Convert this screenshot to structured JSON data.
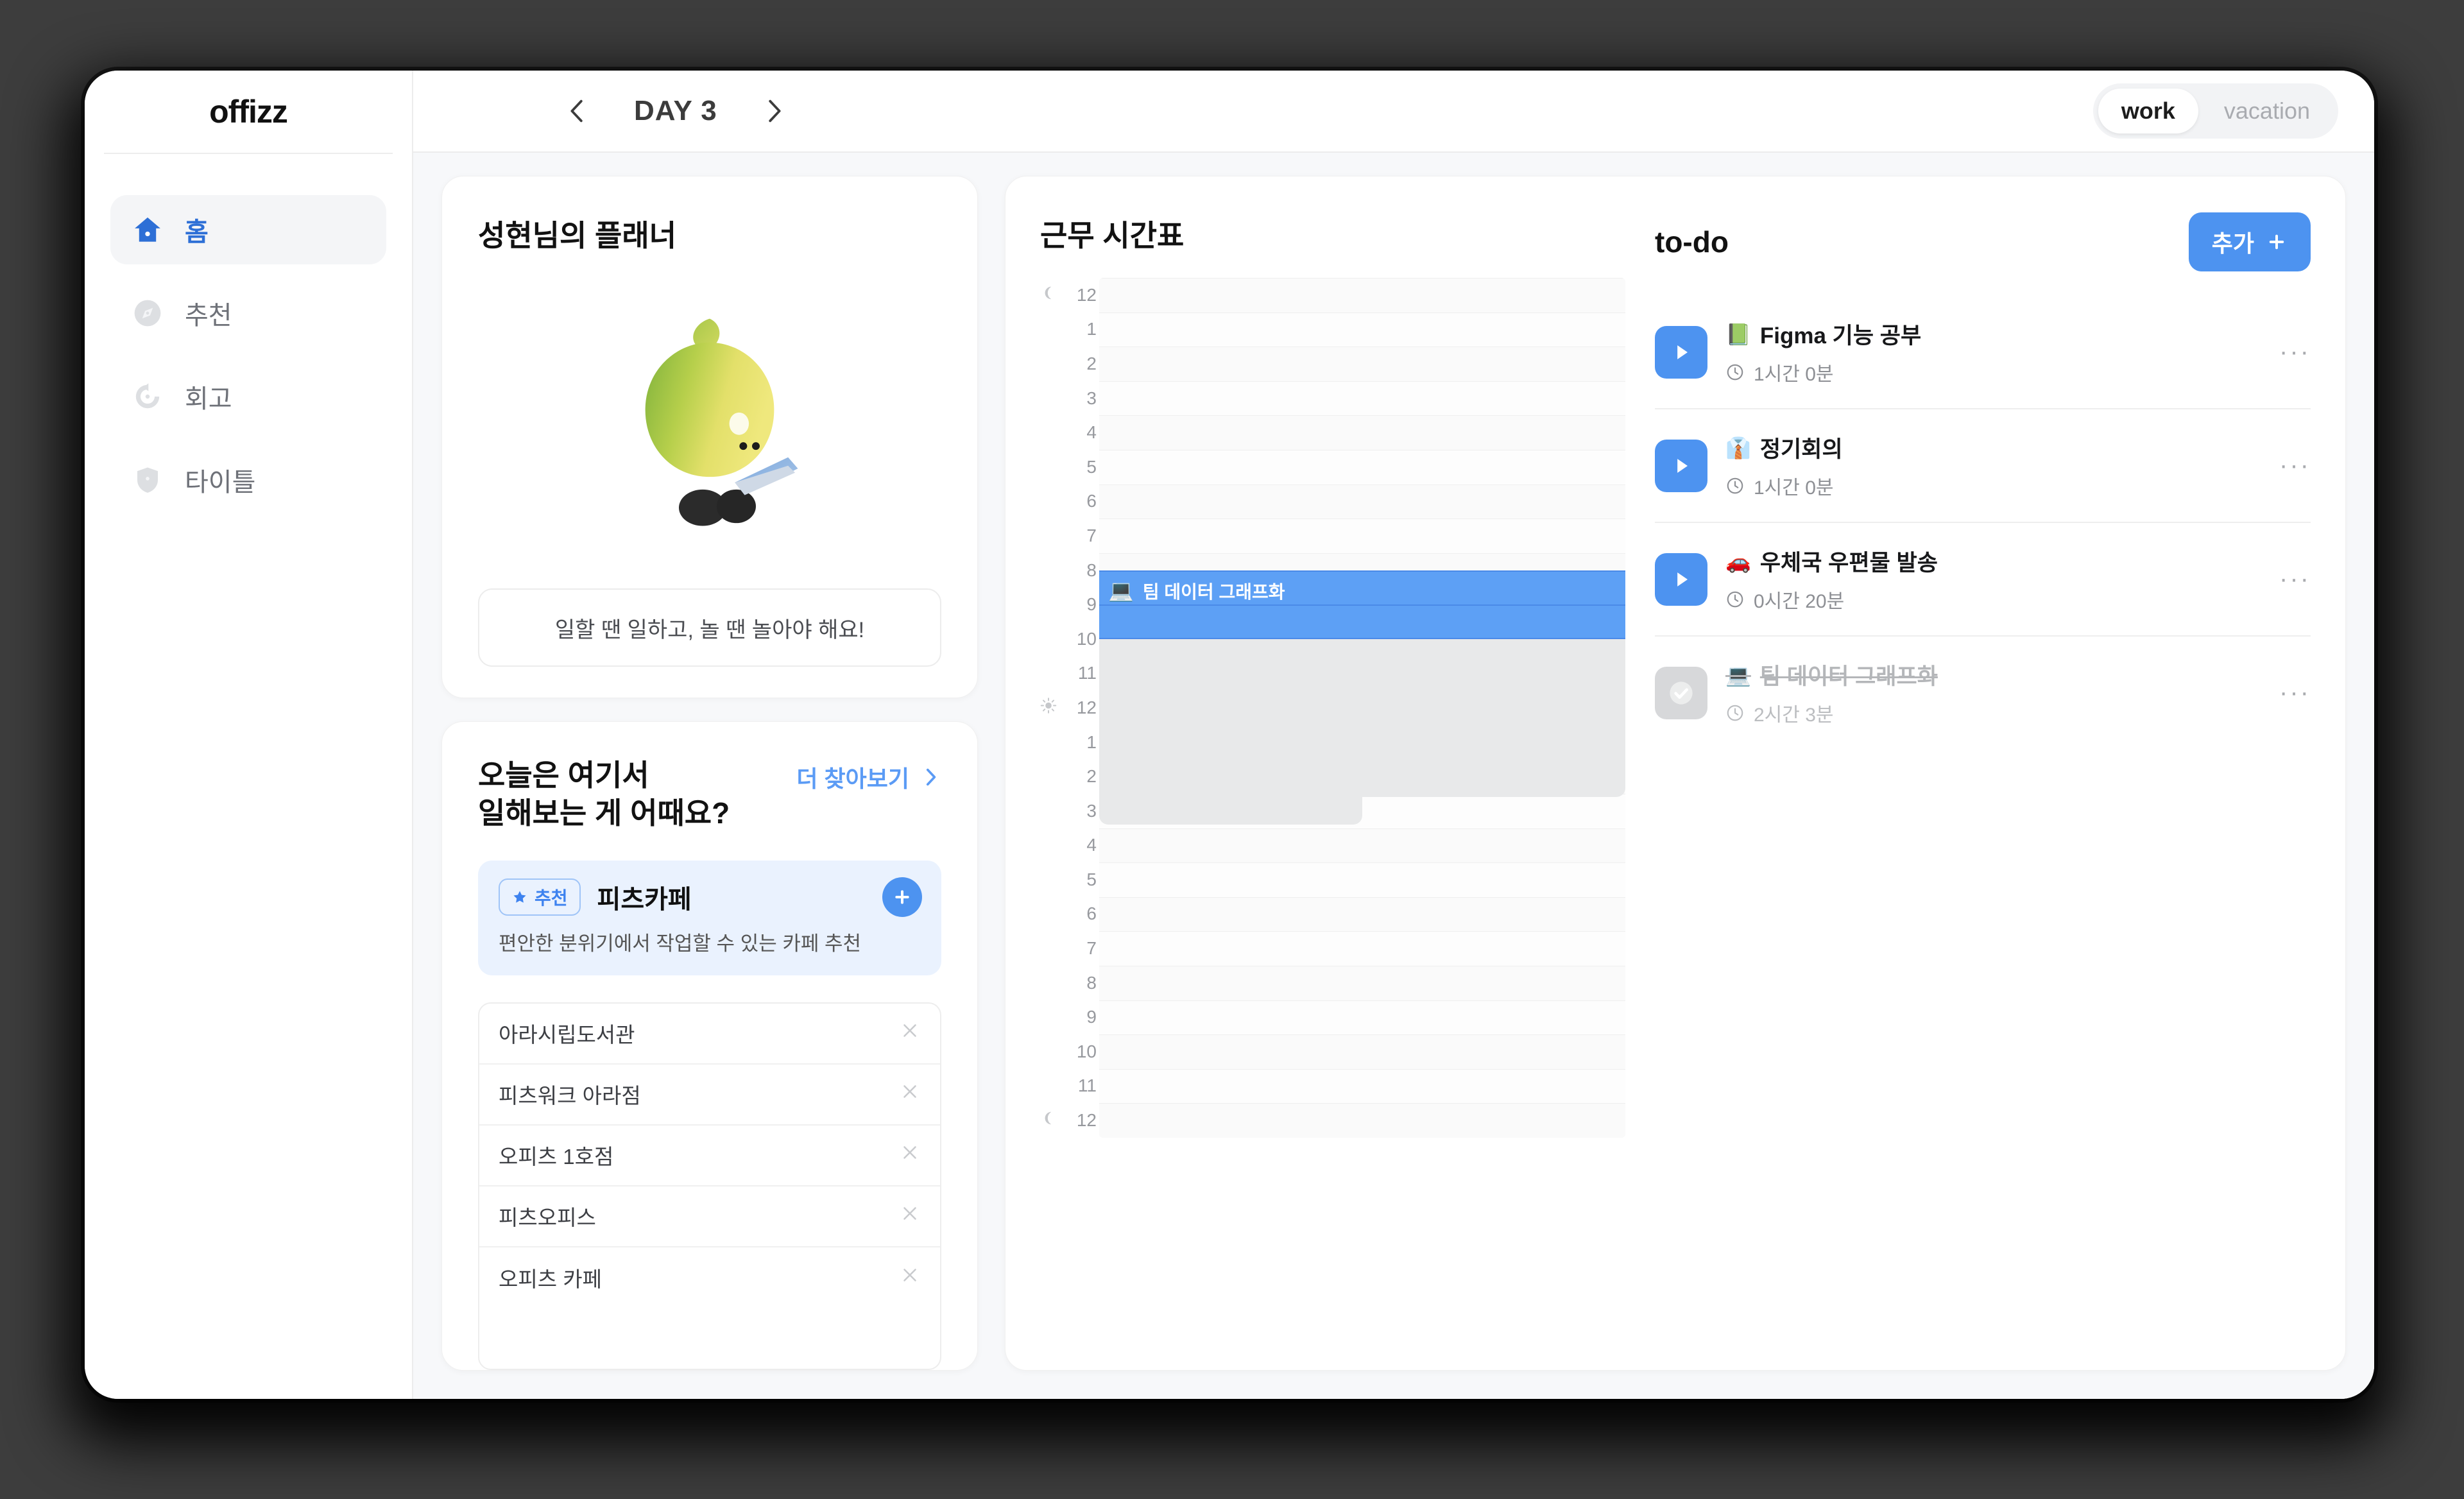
{
  "brand": "offizz",
  "sidebar": {
    "items": [
      {
        "label": "홈",
        "icon": "home-icon",
        "active": true
      },
      {
        "label": "추천",
        "icon": "compass-icon",
        "active": false
      },
      {
        "label": "회고",
        "icon": "refresh-icon",
        "active": false
      },
      {
        "label": "타이틀",
        "icon": "shield-icon",
        "active": false
      }
    ]
  },
  "topbar": {
    "prev_icon": "chevron-left-icon",
    "next_icon": "chevron-right-icon",
    "day_label": "DAY 3",
    "mode_toggle": {
      "options": [
        "work",
        "vacation"
      ],
      "selected": "work"
    }
  },
  "planner": {
    "title": "성현님의 플래너",
    "mascot": "lemon-character-with-laptop",
    "quote": "일할 땐 일하고, 놀 땐 놀아야 해요!"
  },
  "recommend": {
    "title_line1": "오늘은 여기서",
    "title_line2": "일해보는 게 어때요?",
    "more_label": "더 찾아보기",
    "more_icon": "chevron-right-icon",
    "featured": {
      "badge": "추천",
      "badge_icon": "star-icon",
      "name": "피츠카페",
      "description": "편안한 분위기에서 작업할 수 있는 카페 추천",
      "add_icon": "plus-icon"
    },
    "places": [
      {
        "name": "아라시립도서관",
        "remove_icon": "close-icon"
      },
      {
        "name": "피츠워크 아라점",
        "remove_icon": "close-icon"
      },
      {
        "name": "오피츠 1호점",
        "remove_icon": "close-icon"
      },
      {
        "name": "피츠오피스",
        "remove_icon": "close-icon"
      },
      {
        "name": "오피츠 카페",
        "remove_icon": "close-icon"
      }
    ]
  },
  "timetable": {
    "title": "근무 시간표",
    "hours": [
      {
        "label": "12",
        "icon": "moon-icon"
      },
      {
        "label": "1",
        "icon": ""
      },
      {
        "label": "2",
        "icon": ""
      },
      {
        "label": "3",
        "icon": ""
      },
      {
        "label": "4",
        "icon": ""
      },
      {
        "label": "5",
        "icon": ""
      },
      {
        "label": "6",
        "icon": ""
      },
      {
        "label": "7",
        "icon": ""
      },
      {
        "label": "8",
        "icon": ""
      },
      {
        "label": "9",
        "icon": ""
      },
      {
        "label": "10",
        "icon": ""
      },
      {
        "label": "11",
        "icon": ""
      },
      {
        "label": "12",
        "icon": "sun-icon"
      },
      {
        "label": "1",
        "icon": ""
      },
      {
        "label": "2",
        "icon": ""
      },
      {
        "label": "3",
        "icon": ""
      },
      {
        "label": "4",
        "icon": ""
      },
      {
        "label": "5",
        "icon": ""
      },
      {
        "label": "6",
        "icon": ""
      },
      {
        "label": "7",
        "icon": ""
      },
      {
        "label": "8",
        "icon": ""
      },
      {
        "label": "9",
        "icon": ""
      },
      {
        "label": "10",
        "icon": ""
      },
      {
        "label": "11",
        "icon": ""
      },
      {
        "label": "12",
        "icon": "moon-icon"
      }
    ],
    "event": {
      "label": "팀 데이터 그래프화",
      "emoji": "💻",
      "start_hour_index": 9,
      "end_hour_index": 11,
      "color": "#5da0f5"
    },
    "busy_blocks": [
      {
        "start_hour_index": 11,
        "end_hour_index": 15.6,
        "width_pct": 100,
        "color": "#e8e9ea"
      },
      {
        "start_hour_index": 15.6,
        "end_hour_index": 16.4,
        "width_pct": 50,
        "color": "#e8e9ea"
      }
    ]
  },
  "todo": {
    "title": "to-do",
    "add_label": "추가",
    "add_icon": "plus-icon",
    "items": [
      {
        "emoji": "📗",
        "name": "Figma 기능 공부",
        "duration": "1시간 0분",
        "done": false,
        "action_icon": "play-icon",
        "menu_icon": "more-icon",
        "clock_icon": "clock-icon"
      },
      {
        "emoji": "👔",
        "name": "정기회의",
        "duration": "1시간 0분",
        "done": false,
        "action_icon": "play-icon",
        "menu_icon": "more-icon",
        "clock_icon": "clock-icon"
      },
      {
        "emoji": "🚗",
        "name": "우체국 우편물 발송",
        "duration": "0시간 20분",
        "done": false,
        "action_icon": "play-icon",
        "menu_icon": "more-icon",
        "clock_icon": "clock-icon"
      },
      {
        "emoji": "💻",
        "name": "팀 데이터 그래프화",
        "duration": "2시간 3분",
        "done": true,
        "action_icon": "check-icon",
        "menu_icon": "more-icon",
        "clock_icon": "clock-icon"
      }
    ]
  },
  "colors": {
    "accent": "#4d93f0",
    "accent_light": "#5da0f5",
    "accent_soft_bg": "#eaf2fe",
    "page_bg": "#f7f8fa",
    "desktop_bg": "#3d3d3d"
  }
}
